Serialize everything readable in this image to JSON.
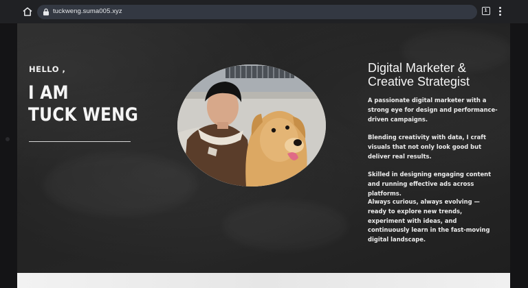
{
  "browser": {
    "url": "tuckweng.suma005.xyz",
    "tab_count": "1"
  },
  "hero": {
    "greeting": "HELLO ,",
    "name_line1": "I AM",
    "name_line2": "TUCK WENG",
    "role_line1": "Digital Marketer &",
    "role_line2": "Creative Strategist",
    "paragraphs": [
      "A passionate digital marketer with a strong eye for design and performance-driven campaigns.",
      "Blending creativity with data, I craft visuals that not only look good but deliver real results.",
      "Skilled in designing engaging content and running effective ads across platforms.",
      "Always curious, always evolving — ready to explore new trends, experiment with ideas, and continuously learn in the fast-moving digital landscape."
    ]
  },
  "colors": {
    "background": "#262626",
    "text": "#f4f4f4",
    "browser_bar": "#202124",
    "url_pill": "#333842"
  }
}
